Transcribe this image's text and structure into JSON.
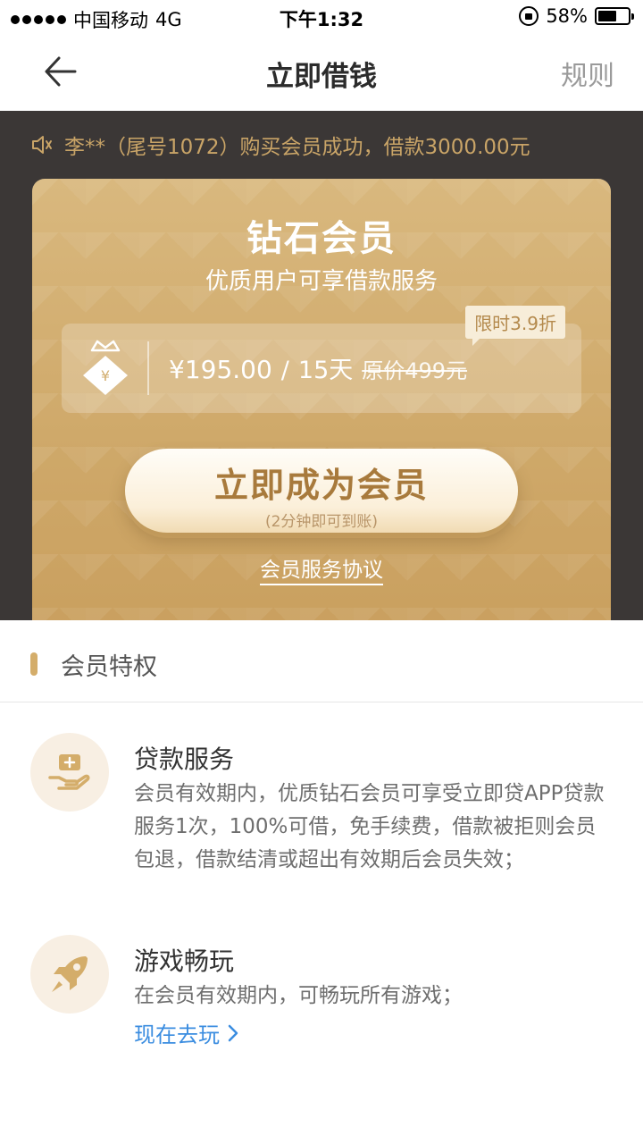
{
  "status_bar": {
    "carrier": "中国移动",
    "network": "4G",
    "time": "下午1:32",
    "battery": "58%"
  },
  "nav": {
    "title": "立即借钱",
    "rules": "规则"
  },
  "notice": {
    "text": "李**（尾号1072）购买会员成功，借款3000.00元"
  },
  "card": {
    "title": "钻石会员",
    "subtitle": "优质用户可享借款服务",
    "price": "¥195.00",
    "separator": "/",
    "duration": "15天",
    "original_price": "原价499元",
    "discount_badge": "限时3.9折",
    "cta_main": "立即成为会员",
    "cta_sub": "(2分钟即可到账)",
    "agreement": "会员服务协议"
  },
  "privileges": {
    "section_title": "会员特权",
    "items": [
      {
        "icon": "loan-icon",
        "title": "贷款服务",
        "desc": "会员有效期内，优质钻石会员可享受立即贷APP贷款服务1次，100%可借，免手续费，借款被拒则会员包退，借款结清或超出有效期后会员失效；"
      },
      {
        "icon": "rocket-icon",
        "title": "游戏畅玩",
        "desc": "在会员有效期内，可畅玩所有游戏；",
        "link": "现在去玩"
      }
    ]
  },
  "colors": {
    "gold": "#cfa96a",
    "dark_bg": "#3b3736",
    "link_blue": "#3b8de0"
  }
}
